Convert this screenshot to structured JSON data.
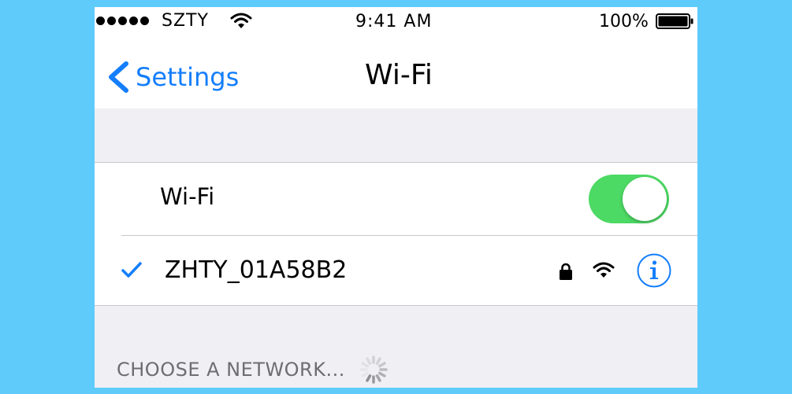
{
  "status_bar": {
    "carrier": "SZTY",
    "time": "9:41 AM",
    "battery": "100%"
  },
  "nav": {
    "back_label": "Settings",
    "title": "Wi-Fi"
  },
  "wifi_toggle": {
    "label": "Wi-Fi",
    "on": true
  },
  "connected_network": {
    "name": "ZHTY_01A58B2",
    "secured": true,
    "selected": true
  },
  "section": {
    "choose_label": "CHOOSE A NETWORK..."
  },
  "colors": {
    "accent": "#147efb",
    "toggle_on": "#4cd964",
    "background": "#5ecbfb"
  }
}
